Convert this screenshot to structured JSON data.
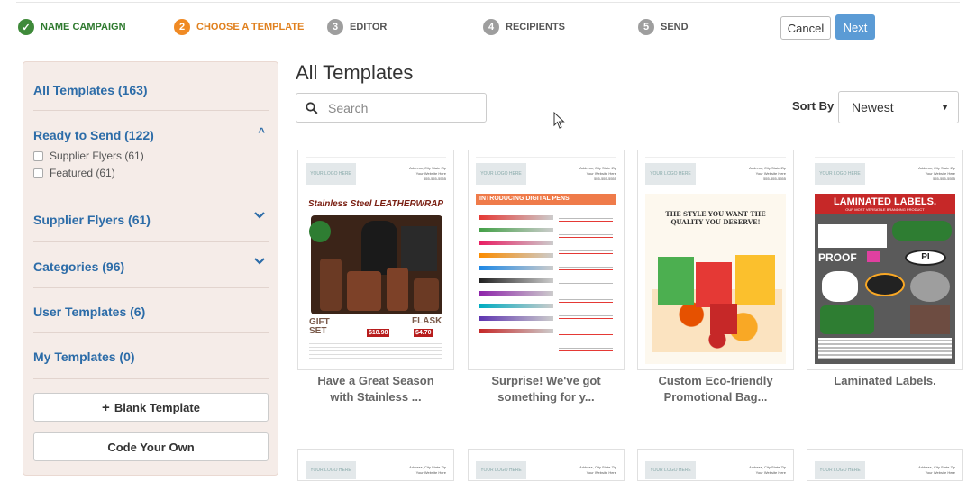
{
  "steps": [
    {
      "num": "✓",
      "label": "NAME CAMPAIGN"
    },
    {
      "num": "2",
      "label": "CHOOSE A TEMPLATE"
    },
    {
      "num": "3",
      "label": "EDITOR"
    },
    {
      "num": "4",
      "label": "RECIPIENTS"
    },
    {
      "num": "5",
      "label": "SEND"
    }
  ],
  "actions": {
    "cancel": "Cancel",
    "next": "Next"
  },
  "sidebar": {
    "all_templates": "All Templates (163)",
    "ready_to_send": "Ready to Send (122)",
    "ready_items": [
      "Supplier Flyers (61)",
      "Featured (61)"
    ],
    "supplier_flyers": "Supplier Flyers (61)",
    "categories": "Categories (96)",
    "user_templates": "User Templates (6)",
    "my_templates": "My Templates (0)",
    "blank_template": "Blank Template",
    "code_your_own": "Code Your Own"
  },
  "main": {
    "title": "All Templates",
    "search_placeholder": "Search",
    "sort_label": "Sort By",
    "sort_value": "Newest"
  },
  "template_header": {
    "logo": "YOUR LOGO HERE",
    "address": "Address, City State Zip",
    "website": "Your Website Here",
    "phone": "555-555-5555"
  },
  "templates": [
    {
      "caption_line1": "Have a Great Season",
      "caption_line2": "with Stainless ...",
      "art_title": "Stainless Steel LEATHERWRAP",
      "badge1": "GIFT SET",
      "badge2": "FLASK",
      "price1": "$18.98",
      "price2": "$4.70"
    },
    {
      "caption_line1": "Surprise! We've got",
      "caption_line2": "something for y...",
      "art_title": "INTRODUCING DIGITAL PENS"
    },
    {
      "caption_line1": "Custom Eco-friendly",
      "caption_line2": "Promotional Bag...",
      "art_title": "THE STYLE YOU WANT THE QUALITY YOU DESERVE!"
    },
    {
      "caption_line1": "Laminated Labels.",
      "caption_line2": "",
      "art_title": "LAMINATED LABELS.",
      "art_sub": "OUR MOST VERSATILE BRANDING PRODUCT",
      "proof": "PROOF",
      "pi": "PI"
    }
  ],
  "colors": {
    "accent_blue": "#2c6ca8",
    "done_green": "#3f8a3a",
    "active_orange": "#f08a24",
    "next_button": "#5b9bd5"
  }
}
